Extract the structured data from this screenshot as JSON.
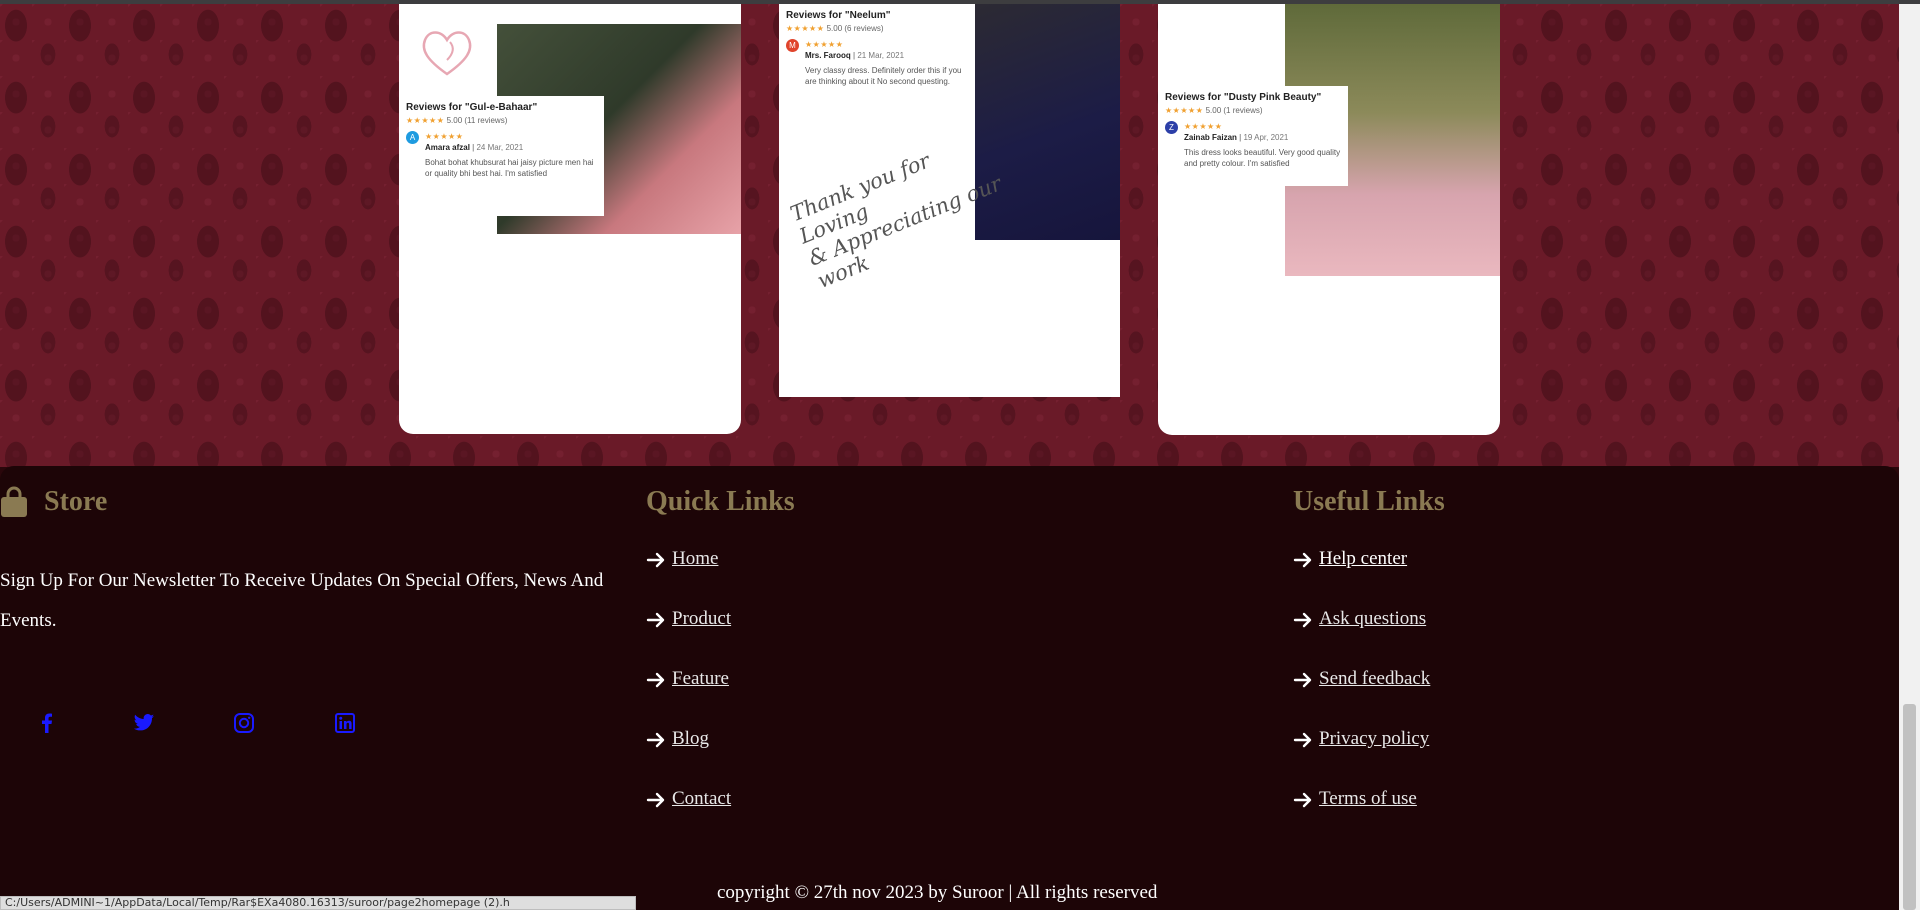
{
  "reviews": [
    {
      "title": "Reviews for \"Gul-e-Bahaar\"",
      "rating": "5.00 (11 reviews)",
      "stars": "★★★★★",
      "initial": "A",
      "avatar_color": "#1e9be0",
      "author": "Amara afzal",
      "date": "24 Mar, 2021",
      "text": "Bohat bohat khubsurat hai jaisy picture men hai or quality bhi best hai. I'm satisfied"
    },
    {
      "title": "Reviews for \"Neelum\"",
      "rating": "5.00 (6 reviews)",
      "stars": "★★★★★",
      "initial": "M",
      "avatar_color": "#e0442c",
      "author": "Mrs. Farooq",
      "date": "21 Mar, 2021",
      "text": "Very classy dress. Definitely order this if you are thinking about it No second questing.",
      "note": "Thank you for Loving\n& Appreciating our\nwork"
    },
    {
      "title": "Reviews for \"Dusty Pink Beauty\"",
      "rating": "5.00 (1 reviews)",
      "stars": "★★★★★",
      "initial": "Z",
      "avatar_color": "#2c3fa8",
      "author": "Zainab Faizan",
      "date": "19 Apr, 2021",
      "text": "This dress looks beautiful. Very good quality and pretty colour. I'm satisfied"
    }
  ],
  "footer": {
    "store_title": "Store",
    "newsletter": "Sign Up For Our Newsletter To Receive Updates On Special Offers, News And Events.",
    "socials": [
      "facebook-icon",
      "twitter-icon",
      "instagram-icon",
      "linkedin-icon"
    ],
    "quick_links_title": "Quick Links",
    "quick_links": [
      " Home",
      " Product",
      " Feature",
      " Blog",
      " Contact"
    ],
    "useful_links_title": "Useful Links",
    "useful_links": [
      " Help center",
      " Ask questions",
      " Send feedback",
      " Privacy policy",
      " Terms of use"
    ],
    "copyright": "copyright © 27th nov 2023 by Suroor | All rights reserved"
  },
  "status_url": "C:/Users/ADMINI~1/AppData/Local/Temp/Rar$EXa4080.16313/suroor/page2homepage (2).h",
  "colors": {
    "accent_heading": "#8a7a52",
    "footer_bg": "#1d0507",
    "banner_bg": "#6a1a28",
    "social_icon": "#1a1aff"
  }
}
